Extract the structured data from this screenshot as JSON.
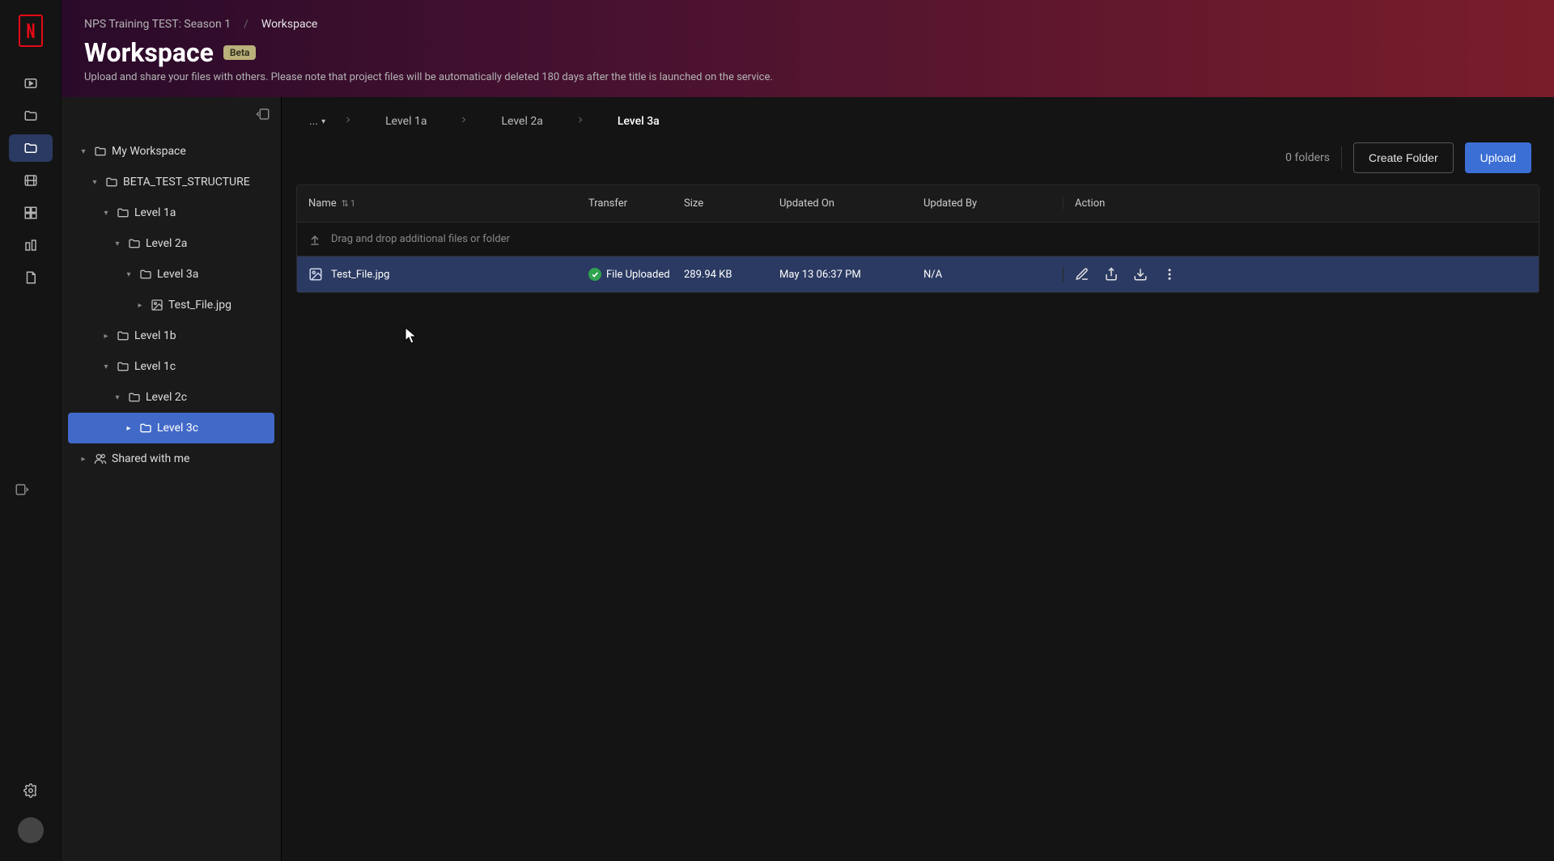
{
  "header": {
    "crumb_project": "NPS Training TEST: Season 1",
    "crumb_current": "Workspace",
    "title": "Workspace",
    "badge": "Beta",
    "subtitle": "Upload and share your files with others. Please note that project files will be automatically deleted 180 days after the title is launched on the service."
  },
  "tree": {
    "nodes": [
      {
        "label": "My Workspace",
        "depth": 0,
        "icon": "folder",
        "expanded": true,
        "selected": false
      },
      {
        "label": "BETA_TEST_STRUCTURE",
        "depth": 1,
        "icon": "folder",
        "expanded": true,
        "selected": false
      },
      {
        "label": "Level 1a",
        "depth": 2,
        "icon": "folder",
        "expanded": true,
        "selected": false
      },
      {
        "label": "Level 2a",
        "depth": 3,
        "icon": "folder",
        "expanded": true,
        "selected": false
      },
      {
        "label": "Level 3a",
        "depth": 4,
        "icon": "folder",
        "expanded": true,
        "selected": false
      },
      {
        "label": "Test_File.jpg",
        "depth": 5,
        "icon": "image",
        "expanded": false,
        "selected": false,
        "leaf": true
      },
      {
        "label": "Level 1b",
        "depth": 2,
        "icon": "folder",
        "expanded": false,
        "selected": false,
        "leaf": true
      },
      {
        "label": "Level 1c",
        "depth": 2,
        "icon": "folder",
        "expanded": true,
        "selected": false
      },
      {
        "label": "Level 2c",
        "depth": 3,
        "icon": "folder",
        "expanded": true,
        "selected": false
      },
      {
        "label": "Level 3c",
        "depth": 4,
        "icon": "folder",
        "expanded": false,
        "selected": true,
        "leaf": true
      },
      {
        "label": "Shared with me",
        "depth": 0,
        "icon": "people",
        "expanded": false,
        "selected": false,
        "leaf": true
      }
    ]
  },
  "breadcrumb": {
    "ellipsis": "...",
    "items": [
      "Level 1a",
      "Level 2a",
      "Level 3a"
    ]
  },
  "toolbar": {
    "folder_count": "0 folders",
    "create_folder": "Create Folder",
    "upload": "Upload"
  },
  "table": {
    "columns": {
      "name": "Name",
      "transfer": "Transfer",
      "size": "Size",
      "updated_on": "Updated On",
      "updated_by": "Updated By",
      "action": "Action"
    },
    "sort_indicator": "1",
    "drop_hint": "Drag and drop additional files or folder",
    "rows": [
      {
        "name": "Test_File.jpg",
        "transfer": "File Uploaded",
        "size": "289.94 KB",
        "updated_on": "May 13 06:37 PM",
        "updated_by": "N/A"
      }
    ]
  }
}
